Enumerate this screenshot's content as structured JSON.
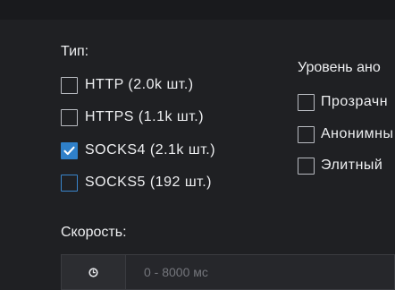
{
  "type_section": {
    "title": "Тип:",
    "options": [
      {
        "label": "HTTP (2.0k шт.)",
        "checked": false
      },
      {
        "label": "HTTPS (1.1k шт.)",
        "checked": false
      },
      {
        "label": "SOCKS4 (2.1k шт.)",
        "checked": true
      },
      {
        "label": "SOCKS5 (192 шт.)",
        "checked": false
      }
    ]
  },
  "anonymity_section": {
    "title": "Уровень ано",
    "options": [
      {
        "label": "Прозрачн",
        "checked": false
      },
      {
        "label": "Анонимны",
        "checked": false
      },
      {
        "label": "Элитный",
        "checked": false
      }
    ]
  },
  "speed_section": {
    "title": "Скорость:",
    "icon": "clock-icon",
    "placeholder": "0 - 8000 мс",
    "value": ""
  },
  "colors": {
    "background": "#1f2023",
    "accent": "#2f80c9",
    "text": "#eeeff1"
  }
}
